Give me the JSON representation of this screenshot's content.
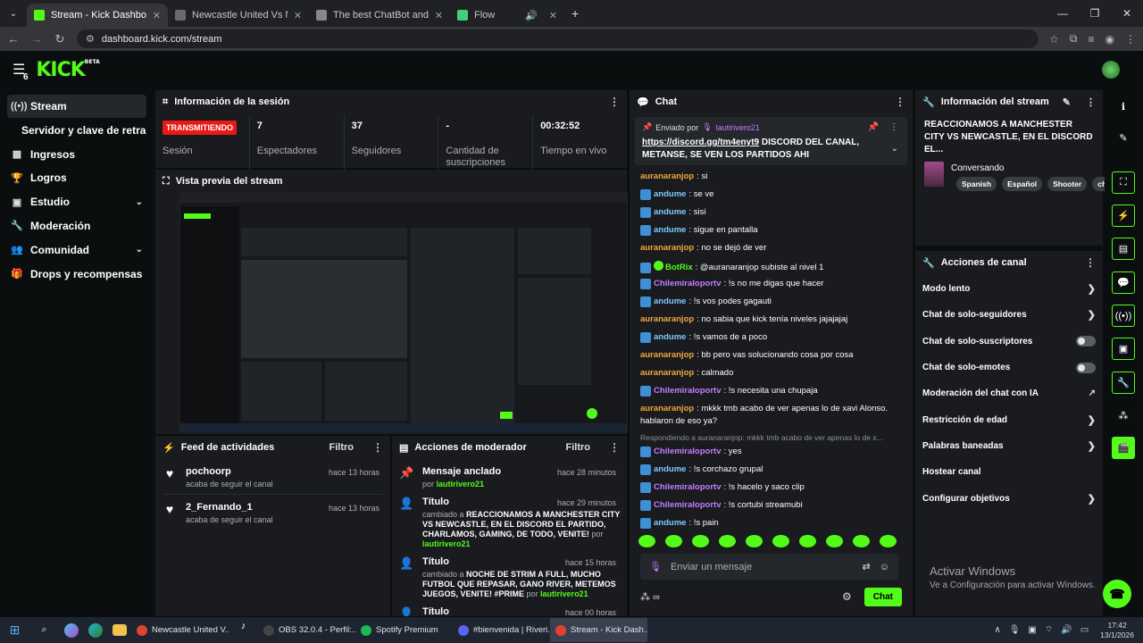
{
  "browser": {
    "tabs": [
      {
        "title": "Stream - Kick Dashboard",
        "active": true,
        "favicon_color": "#53fc18"
      },
      {
        "title": "Newcastle United Vs Manchest",
        "active": false,
        "favicon_color": "#6b6b6b"
      },
      {
        "title": "The best ChatBot and Widgets",
        "active": false,
        "favicon_color": "#888888"
      },
      {
        "title": "Flow",
        "active": false,
        "favicon_color": "#3fd07a"
      }
    ],
    "url": "dashboard.kick.com/stream"
  },
  "header": {
    "logo": "KICK",
    "logo_sup": "BETA",
    "notif_count": "6"
  },
  "sidebar": {
    "items": [
      {
        "label": "Stream",
        "icon": "broadcast-icon",
        "glyph": "((•))",
        "active": true
      },
      {
        "label": "Servidor y clave de retransm",
        "sub": true
      },
      {
        "label": "Ingresos",
        "icon": "chart-icon",
        "glyph": "▦"
      },
      {
        "label": "Logros",
        "icon": "trophy-icon",
        "glyph": "🏆"
      },
      {
        "label": "Estudio",
        "icon": "studio-icon",
        "glyph": "▣",
        "chevron": true
      },
      {
        "label": "Moderación",
        "icon": "wrench-icon",
        "glyph": "🔧"
      },
      {
        "label": "Comunidad",
        "icon": "community-icon",
        "glyph": "👥",
        "chevron": true
      },
      {
        "label": "Drops y recompensas",
        "icon": "gift-icon",
        "glyph": "🎁"
      }
    ]
  },
  "session": {
    "title": "Información de la sesión",
    "live_badge": "TRANSMITIENDO",
    "stats": [
      {
        "value": "",
        "label": "Sesión"
      },
      {
        "value": "7",
        "label": "Espectadores"
      },
      {
        "value": "37",
        "label": "Seguidores"
      },
      {
        "value": "-",
        "label": "Cantidad de suscripciones"
      },
      {
        "value": "00:32:52",
        "label": "Tiempo en vivo"
      }
    ]
  },
  "preview": {
    "title": "Vista previa del stream"
  },
  "feed": {
    "title": "Feed de actividades",
    "filter": "Filtro",
    "items": [
      {
        "name": "pochoorp",
        "desc": "acaba de seguir el canal",
        "time": "hace 13 horas"
      },
      {
        "name": "2_Fernando_1",
        "desc": "acaba de seguir el canal",
        "time": "hace 13 horas"
      }
    ]
  },
  "modactions": {
    "title": "Acciones de moderador",
    "filter": "Filtro",
    "items": [
      {
        "icon": "pin-icon",
        "glyph": "📌",
        "title": "Mensaje anclado",
        "desc_prefix": "por ",
        "desc_main": "",
        "desc_user": "lautirivero21",
        "time": "hace 28 minutos"
      },
      {
        "icon": "title-icon",
        "glyph": "👤",
        "title": "Título",
        "desc_prefix": "cambiado a ",
        "desc_main": "REACCIONAMOS A MANCHESTER CITY VS NEWCASTLE, EN EL DISCORD EL PARTIDO, CHARLAMOS, GAMING, DE TODO, VENITE!",
        "desc_by": " por ",
        "desc_user": "lautirivero21",
        "time": "hace 29 minutos"
      },
      {
        "icon": "title-icon",
        "glyph": "👤",
        "title": "Título",
        "desc_prefix": "cambiado a ",
        "desc_main": "NOCHE DE STRIM A FULL, MUCHO FUTBOL QUE REPASAR, GANO RIVER, METEMOS JUEGOS, VENITE! #PRIME",
        "desc_by": " por ",
        "desc_user": "lautirivero21",
        "time": "hace 15 horas"
      },
      {
        "icon": "title-icon",
        "glyph": "👤",
        "title": "Título",
        "desc_prefix": "",
        "desc_main": "",
        "desc_user": "",
        "time": "hace 00 horas"
      }
    ]
  },
  "chat": {
    "title": "Chat",
    "pinned": {
      "by_label": "Enviado por",
      "by_user": "lautirivero21",
      "link": "https://discord.gg/tm4enyt9",
      "text": "DISCORD DEL CANAL, METANSE, SE VEN LOS PARTIDOS AHI"
    },
    "messages": [
      {
        "user": "auranaranjop",
        "color": "#f2a93b",
        "badge": false,
        "text": "si"
      },
      {
        "user": "andume",
        "color": "#7ecbff",
        "badge": true,
        "text": "se ve"
      },
      {
        "user": "andume",
        "color": "#7ecbff",
        "badge": true,
        "text": "sisi"
      },
      {
        "user": "andume",
        "color": "#7ecbff",
        "badge": true,
        "text": "sigue en pantalla"
      },
      {
        "user": "auranaranjop",
        "color": "#f2a93b",
        "badge": false,
        "text": "no se dejó de ver"
      },
      {
        "user": "BotRix",
        "color": "#53fc18",
        "badge": true,
        "bot": true,
        "text": "@auranaranjop subiste al nivel 1"
      },
      {
        "user": "Chilemiraloportv",
        "color": "#c77dff",
        "badge": true,
        "text": "!s no me digas que hacer"
      },
      {
        "user": "andume",
        "color": "#7ecbff",
        "badge": true,
        "text": "!s vos podes gagauti"
      },
      {
        "user": "auranaranjop",
        "color": "#f2a93b",
        "badge": false,
        "text": "no sabia que kick tenía niveles jajajajaj"
      },
      {
        "user": "andume",
        "color": "#7ecbff",
        "badge": true,
        "text": "!s vamos de a poco"
      },
      {
        "user": "auranaranjop",
        "color": "#f2a93b",
        "badge": false,
        "text": "bb pero vas solucionando cosa por cosa"
      },
      {
        "user": "auranaranjop",
        "color": "#f2a93b",
        "badge": false,
        "text": "calmado"
      },
      {
        "user": "Chilemiraloportv",
        "color": "#c77dff",
        "badge": true,
        "text": "!s necesita una chupaja"
      },
      {
        "user": "auranaranjop",
        "color": "#f2a93b",
        "badge": false,
        "text": "mkkk tmb acabo de ver apenas lo de xavi Alonso. hablaron de eso ya?",
        "tall": true
      },
      {
        "reply": "Respondiendo a auranaranjop: mkkk tmb acabo de ver apenas lo de x..."
      },
      {
        "user": "Chilemiraloportv",
        "color": "#c77dff",
        "badge": true,
        "text": "yes"
      },
      {
        "user": "andume",
        "color": "#7ecbff",
        "badge": true,
        "text": "!s corchazo grupal"
      },
      {
        "user": "Chilemiraloportv",
        "color": "#c77dff",
        "badge": true,
        "text": "!s hacelo y saco clip"
      },
      {
        "user": "Chilemiraloportv",
        "color": "#c77dff",
        "badge": true,
        "text": "!s cortubi streamubi"
      },
      {
        "user": "andume",
        "color": "#7ecbff",
        "badge": true,
        "text": "!s pain"
      }
    ],
    "input_placeholder": "Enviar un mensaje",
    "send_label": "Chat"
  },
  "stream_info": {
    "title": "Información del stream",
    "stream_title": "REACCIONAMOS A MANCHESTER CITY VS NEWCASTLE, EN EL DISCORD EL...",
    "category": "Conversando",
    "tags": [
      "Spanish",
      "Español",
      "Shooter",
      "chill"
    ]
  },
  "channel_actions": {
    "title": "Acciones de canal",
    "rows": [
      {
        "label": "Modo lento",
        "control": "chevron"
      },
      {
        "label": "Chat de solo-seguidores",
        "control": "chevron"
      },
      {
        "label": "Chat de solo-suscriptores",
        "control": "toggle",
        "on": false
      },
      {
        "label": "Chat de solo-emotes",
        "control": "toggle",
        "on": false
      },
      {
        "label": "Moderación del chat con IA",
        "control": "external"
      },
      {
        "label": "Restricción de edad",
        "control": "chevron"
      },
      {
        "label": "Palabras baneadas",
        "control": "chevron"
      },
      {
        "label": "Hostear canal",
        "control": "none"
      },
      {
        "label": "Configurar objetivos",
        "control": "chevron"
      }
    ]
  },
  "activate_windows": {
    "line1": "Activar Windows",
    "line2": "Ve a Configuración para activar Windows."
  },
  "taskbar": {
    "apps": [
      {
        "label": "Newcastle United V...",
        "color": "#e0442e",
        "active": false
      },
      {
        "label": "",
        "color": "#000000",
        "active": false,
        "tiktok": true
      },
      {
        "label": "OBS 32.0.4 - Perfil:...",
        "color": "#444444",
        "active": false
      },
      {
        "label": "Spotify Premium",
        "color": "#1db954",
        "active": false
      },
      {
        "label": "#bienvenida | Riveri...",
        "color": "#5865f2",
        "active": false
      },
      {
        "label": "Stream - Kick Dash...",
        "color": "#e0442e",
        "active": true
      }
    ],
    "time": "17:42",
    "date": "13/1/2026"
  }
}
